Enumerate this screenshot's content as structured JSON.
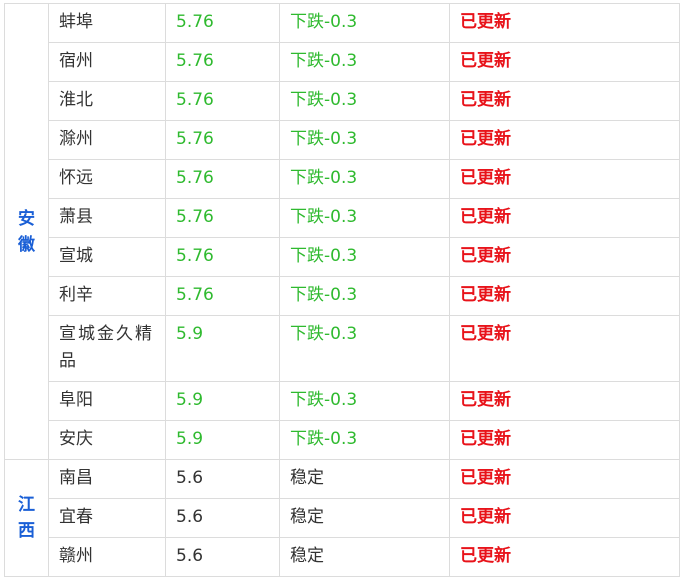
{
  "regions": [
    {
      "name": "安徽",
      "rows": [
        {
          "city": "蚌埠",
          "price": "5.76",
          "change": "下跌-0.3",
          "status": "已更新"
        },
        {
          "city": "宿州",
          "price": "5.76",
          "change": "下跌-0.3",
          "status": "已更新"
        },
        {
          "city": "淮北",
          "price": "5.76",
          "change": "下跌-0.3",
          "status": "已更新"
        },
        {
          "city": "滁州",
          "price": "5.76",
          "change": "下跌-0.3",
          "status": "已更新"
        },
        {
          "city": "怀远",
          "price": "5.76",
          "change": "下跌-0.3",
          "status": "已更新"
        },
        {
          "city": "萧县",
          "price": "5.76",
          "change": "下跌-0.3",
          "status": "已更新"
        },
        {
          "city": "宣城",
          "price": "5.76",
          "change": "下跌-0.3",
          "status": "已更新"
        },
        {
          "city": "利辛",
          "price": "5.76",
          "change": "下跌-0.3",
          "status": "已更新"
        },
        {
          "city": "宣城金久精品",
          "price": "5.9",
          "change": "下跌-0.3",
          "status": "已更新"
        },
        {
          "city": "阜阳",
          "price": "5.9",
          "change": "下跌-0.3",
          "status": "已更新"
        },
        {
          "city": "安庆",
          "price": "5.9",
          "change": "下跌-0.3",
          "status": "已更新"
        }
      ]
    },
    {
      "name": "江西",
      "rows": [
        {
          "city": "南昌",
          "price": "5.6",
          "change": "稳定",
          "status": "已更新"
        },
        {
          "city": "宜春",
          "price": "5.6",
          "change": "稳定",
          "status": "已更新"
        },
        {
          "city": "赣州",
          "price": "5.6",
          "change": "稳定",
          "status": "已更新"
        }
      ]
    }
  ],
  "colors": {
    "region": "#1a5fd6",
    "down": "#2fba2f",
    "stable": "#333333",
    "status": "#e8131a"
  }
}
